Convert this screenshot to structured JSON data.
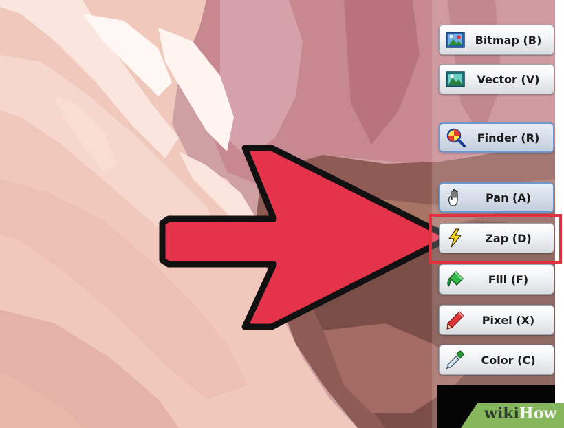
{
  "toolbar": {
    "buttons": [
      {
        "id": "bitmap",
        "label": "Bitmap (B)",
        "icon": "bitmap-image-icon",
        "active": false
      },
      {
        "id": "vector",
        "label": "Vector (V)",
        "icon": "vector-image-icon",
        "active": false
      },
      {
        "id": "finder",
        "label": "Finder (R)",
        "icon": "finder-magnifier-icon",
        "active": true
      },
      {
        "id": "pan",
        "label": "Pan (A)",
        "icon": "hand-icon",
        "active": true
      },
      {
        "id": "zap",
        "label": "Zap (D)",
        "icon": "lightning-bolt-icon",
        "active": false
      },
      {
        "id": "fill",
        "label": "Fill (F)",
        "icon": "paint-bucket-icon",
        "active": false
      },
      {
        "id": "pixel",
        "label": "Pixel (X)",
        "icon": "pencil-icon",
        "active": false
      },
      {
        "id": "color",
        "label": "Color (C)",
        "icon": "eyedropper-icon",
        "active": false
      }
    ]
  },
  "watermark": {
    "part1": "wiki",
    "part2": "How"
  },
  "colors": {
    "arrow": "#e4334a",
    "highlight": "#e1313f",
    "canvas_pink": "#d9a3a8",
    "canvas_mauve": "#c58487",
    "canvas_brown": "#8b5a50"
  }
}
